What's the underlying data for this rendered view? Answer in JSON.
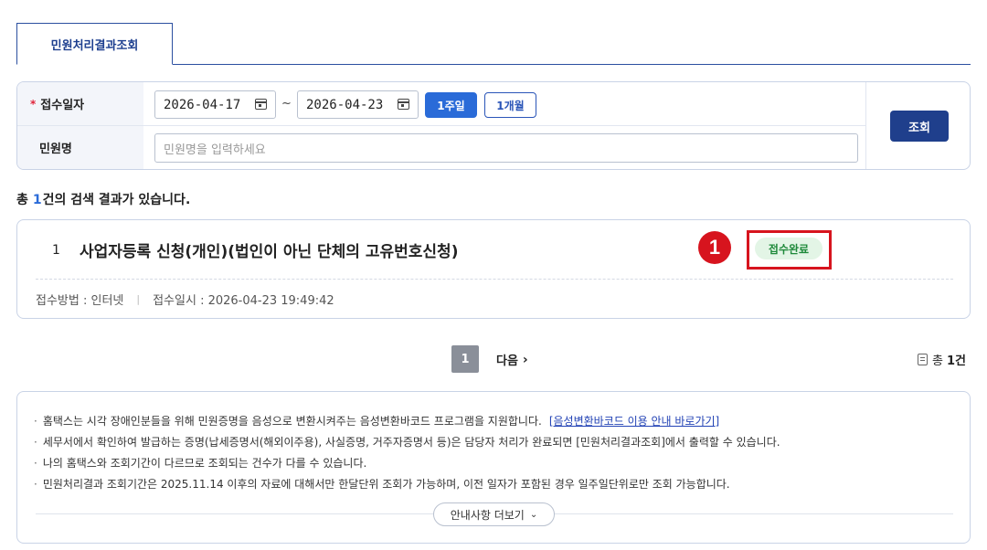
{
  "tabs": [
    {
      "label": "민원처리결과조회"
    }
  ],
  "search": {
    "date_label": "접수일자",
    "required_mark": "*",
    "start_date": "2026-04-17",
    "separator": "~",
    "end_date": "2026-04-23",
    "period_buttons": [
      "1주일",
      "1개월"
    ],
    "name_label": "민원명",
    "name_placeholder": "민원명을 입력하세요",
    "search_button": "조회"
  },
  "result_summary": {
    "prefix": "총",
    "count": "1",
    "suffix": "건의 검색 결과가 있습니다."
  },
  "results": [
    {
      "number": "1",
      "title": "사업자등록 신청(개인)(법인이 아닌 단체의 고유번호신청)",
      "status": "접수완료",
      "method_label": "접수방법 : 인터넷",
      "meta_separator": "|",
      "received_label": "접수일시 : 2026-04-23 19:49:42"
    }
  ],
  "annotation": {
    "marker": "1",
    "color": "#d7141e"
  },
  "pagination": {
    "current": "1",
    "next_label": "다음",
    "next_icon": "chevron-right-icon"
  },
  "total": {
    "prefix": "총",
    "count": "1건"
  },
  "notice": {
    "items": [
      "홈택스는 시각 장애인분들을 위해 민원증명을 음성으로 변환시켜주는 음성변환바코드 프로그램을 지원합니다.",
      "세무서에서 확인하여 발급하는 증명(납세증명서(해외이주용), 사실증명, 거주자증명서 등)은 담당자 처리가 완료되면 [민원처리결과조회]에서 출력할 수 있습니다.",
      "나의 홈택스와 조회기간이 다르므로 조회되는 건수가 다를 수 있습니다.",
      "민원처리결과 조회기간은 2025.11.14 이후의 자료에 대해서만 한달단위 조회가 가능하며, 이전 일자가 포함된 경우 일주일단위로만 조회 가능합니다."
    ],
    "bullet": "·",
    "link_label": "[음성변환바코드 이용 안내 바로가기]",
    "more_button": "안내사항 더보기",
    "more_icon": "chevron-down-icon"
  },
  "colors": {
    "primary": "#1f3f8c",
    "accent": "#2a6bd8",
    "status_green": "#1f8a3b",
    "annotation_red": "#d7141e"
  }
}
